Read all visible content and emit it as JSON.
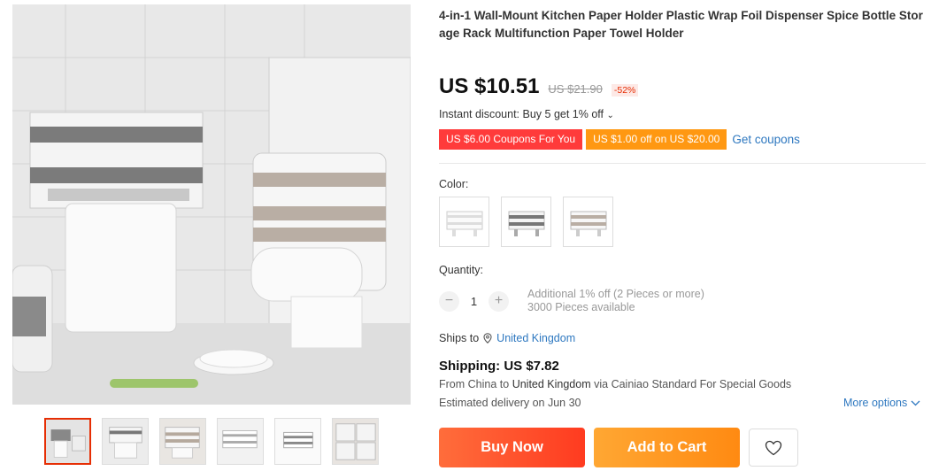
{
  "product": {
    "title": "4-in-1 Wall-Mount Kitchen Paper Holder Plastic Wrap Foil Dispenser Spice Bottle Storage Rack Multifunction Paper Towel Holder"
  },
  "price": {
    "current": "US $10.51",
    "original": "US $21.90",
    "discount": "-52%"
  },
  "instant_discount": "Instant discount: Buy 5 get 1% off",
  "coupons": {
    "items": [
      "US $6.00 Coupons For You",
      "US $1.00 off on US $20.00"
    ],
    "get_label": "Get coupons"
  },
  "color": {
    "label": "Color:",
    "swatch_icons": [
      "rack-white-icon",
      "rack-grey-icon",
      "rack-beige-icon"
    ]
  },
  "quantity": {
    "label": "Quantity:",
    "minus": "−",
    "value": "1",
    "plus": "+",
    "additional": "Additional 1% off (2 Pieces or more)",
    "available": "3000 Pieces available"
  },
  "ships_to": {
    "label": "Ships to",
    "country": "United Kingdom"
  },
  "shipping": {
    "price": "Shipping: US $7.82",
    "from": "From China to",
    "to": "United Kingdom",
    "via": "via Cainiao Standard For Special Goods",
    "delivery": "Estimated delivery on Jun 30",
    "more_options": "More options"
  },
  "actions": {
    "buy_now": "Buy Now",
    "add_to_cart": "Add to Cart"
  },
  "colors": {
    "buy_now": "#ff4a2a",
    "add_to_cart": "#ff9812",
    "coupon_red": "#ff3b3b",
    "coupon_orange": "#ff9812",
    "link": "#2e78c0"
  }
}
